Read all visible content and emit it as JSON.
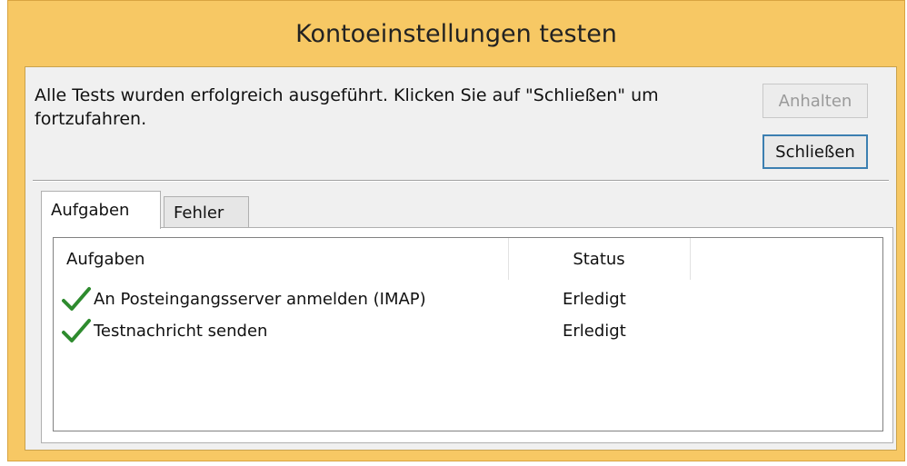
{
  "window": {
    "title": "Kontoeinstellungen testen"
  },
  "message": "Alle Tests wurden erfolgreich ausgeführt. Klicken Sie auf \"Schließen\" um fortzufahren.",
  "buttons": {
    "stop_label": "Anhalten",
    "close_label": "Schließen"
  },
  "tabs": [
    {
      "label": "Aufgaben",
      "active": true
    },
    {
      "label": "Fehler",
      "active": false
    }
  ],
  "table": {
    "columns": [
      "Aufgaben",
      "Status"
    ],
    "rows": [
      {
        "icon": "checkmark-icon",
        "task": "An Posteingangsserver anmelden (IMAP)",
        "status": "Erledigt"
      },
      {
        "icon": "checkmark-icon",
        "task": "Testnachricht senden",
        "status": "Erledigt"
      }
    ]
  },
  "colors": {
    "title_bar": "#f7c864",
    "check": "#2e8b2e",
    "focus_border": "#3c7fb1"
  }
}
